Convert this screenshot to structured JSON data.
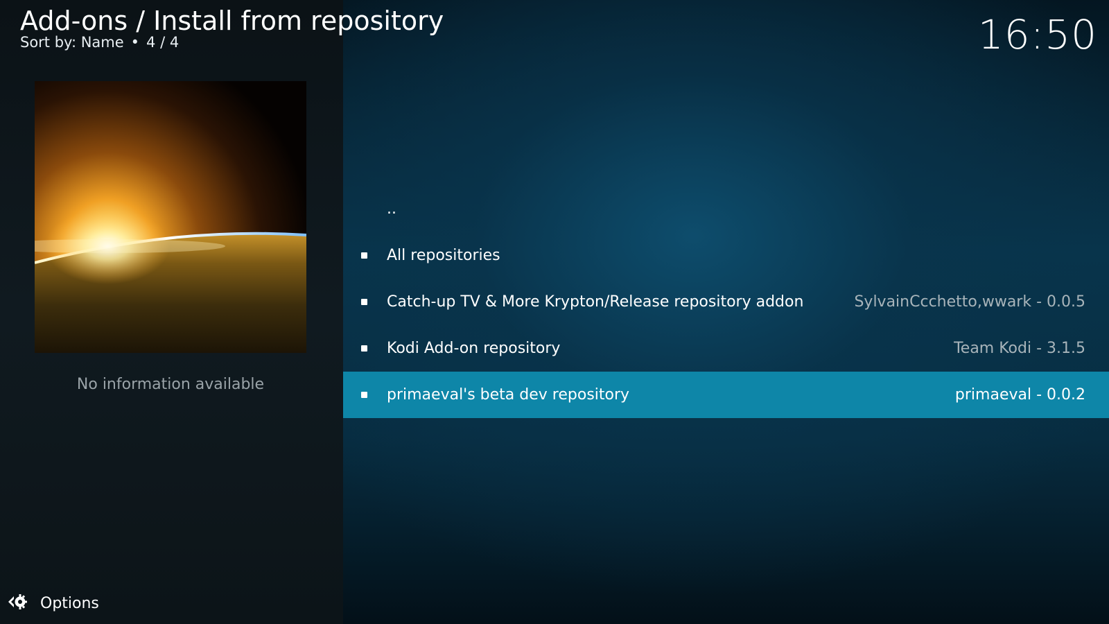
{
  "header": {
    "title": "Add-ons / Install from repository",
    "sort_label": "Sort by: Name",
    "separator": "•",
    "count": "4 / 4"
  },
  "clock": "16:50",
  "info_panel": {
    "thumbnail_icon": "earth-sunrise-image",
    "no_info": "No information available"
  },
  "options": {
    "icon": "gear-icon",
    "label": "Options"
  },
  "list": {
    "items": [
      {
        "label": "..",
        "meta": "",
        "bullet": false,
        "selected": false
      },
      {
        "label": "All repositories",
        "meta": "",
        "bullet": true,
        "selected": false
      },
      {
        "label": "Catch-up TV & More Krypton/Release repository addon",
        "meta": "SylvainCcchetto,wwark - 0.0.5",
        "bullet": true,
        "selected": false
      },
      {
        "label": "Kodi Add-on repository",
        "meta": "Team Kodi - 3.1.5",
        "bullet": true,
        "selected": false
      },
      {
        "label": "primaeval's beta dev repository",
        "meta": "primaeval - 0.0.2",
        "bullet": true,
        "selected": true
      }
    ]
  },
  "colors": {
    "selection": "#0e86a8",
    "meta_text": "#a8b4ba",
    "left_panel": "#0e171c"
  }
}
